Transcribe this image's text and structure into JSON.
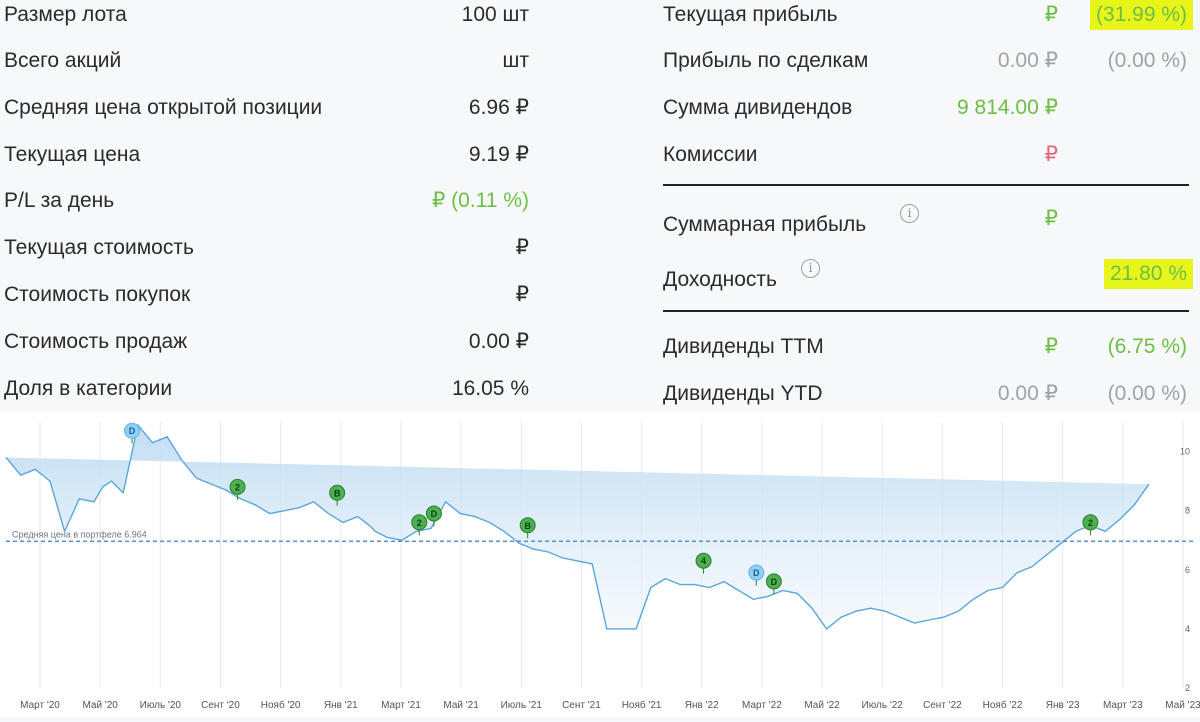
{
  "left": [
    {
      "label": "Размер лота",
      "value": "100 шт",
      "cls": ""
    },
    {
      "label": "Всего акций",
      "value": "шт",
      "cls": ""
    },
    {
      "label": "Средняя цена открытой позиции",
      "value": "6.96 ₽",
      "cls": ""
    },
    {
      "label": "Текущая цена",
      "value": "9.19 ₽",
      "cls": ""
    },
    {
      "label": "P/L за день",
      "value": "₽ (0.11 %)",
      "cls": "green"
    },
    {
      "label": "Текущая стоимость",
      "value": "₽",
      "cls": ""
    },
    {
      "label": "Стоимость покупок",
      "value": "₽",
      "cls": ""
    },
    {
      "label": "Стоимость продаж",
      "value": "0.00 ₽",
      "cls": ""
    },
    {
      "label": "Доля в категории",
      "value": "16.05 %",
      "cls": ""
    }
  ],
  "right": {
    "current_profit": {
      "label": "Текущая прибыль",
      "value": "₽",
      "pct": "(31.99 %)"
    },
    "trade_profit": {
      "label": "Прибыль по сделкам",
      "value": "0.00 ₽",
      "pct": "(0.00 %)"
    },
    "dividends_sum": {
      "label": "Сумма дивидендов",
      "value": "9 814.00 ₽"
    },
    "commissions": {
      "label": "Комиссии",
      "value": "₽"
    },
    "total_profit": {
      "label": "Суммарная прибыль",
      "value": "₽",
      "info": "i"
    },
    "yield": {
      "label": "Доходность",
      "pct": "21.80 %",
      "info": "i"
    },
    "div_ttm": {
      "label": "Дивиденды TTM",
      "value": "₽",
      "pct": "(6.75 %)"
    },
    "div_ytd": {
      "label": "Дивиденды YTD",
      "value": "0.00 ₽",
      "pct": "(0.00 %)"
    }
  },
  "colors": {
    "green": "#6cbf47",
    "highlight": "#e8f51a",
    "line": "#5aa6dd",
    "avg_line": "#3a7fc0",
    "marker_green": "#4caf50",
    "marker_blue": "#8fd0f5"
  },
  "chart_data": {
    "type": "area",
    "avg_label": "Средняя цена в портфеле 6.964",
    "avg_value": 6.964,
    "ylim": [
      2,
      11
    ],
    "yticks": [
      "2",
      "4",
      "6",
      "8",
      "10"
    ],
    "xticks": [
      "Март '20",
      "Май '20",
      "Июль '20",
      "Сент '20",
      "Нояб '20",
      "Янв '21",
      "Март '21",
      "Май '21",
      "Июль '21",
      "Сент '21",
      "Нояб '21",
      "Янв '22",
      "Март '22",
      "Май '22",
      "Июль '22",
      "Сент '22",
      "Нояб '22",
      "Янв '23",
      "Март '23",
      "Май '23"
    ],
    "x": [
      0,
      0.5,
      1,
      1.5,
      2,
      2.5,
      3,
      3.3,
      3.6,
      4,
      4.5,
      5,
      5.5,
      6,
      6.5,
      7,
      7.5,
      8,
      8.5,
      9,
      9.5,
      10,
      10.5,
      11,
      11.5,
      12,
      12.4,
      12.6,
      13,
      13.5,
      14,
      14.5,
      15,
      15.5,
      16,
      16.5,
      17,
      17.5,
      18,
      18.5,
      19,
      19.5,
      20,
      20.5,
      21,
      21.5,
      22,
      22.5,
      23,
      23.5,
      24,
      24.5,
      25,
      25.5,
      26,
      26.5,
      27,
      27.5,
      28,
      28.5,
      29,
      29.5,
      30,
      30.5,
      31,
      31.5,
      32,
      32.5,
      33,
      33.5,
      34,
      34.5,
      35,
      35.5,
      36,
      36.5,
      37,
      37.5,
      38,
      38.5,
      39,
      39.5,
      40,
      40.5
    ],
    "y": [
      9.8,
      9.2,
      9.4,
      9.0,
      7.3,
      8.4,
      8.3,
      8.8,
      9.0,
      8.6,
      10.9,
      10.3,
      10.5,
      9.7,
      9.1,
      8.9,
      8.7,
      8.4,
      8.2,
      7.9,
      8.0,
      8.1,
      8.3,
      7.9,
      7.6,
      7.8,
      7.5,
      7.3,
      7.1,
      7.0,
      7.3,
      7.4,
      8.3,
      7.9,
      7.8,
      7.6,
      7.3,
      6.9,
      6.7,
      6.6,
      6.4,
      6.3,
      6.2,
      4.0,
      4.0,
      4.0,
      5.4,
      5.7,
      5.5,
      5.5,
      5.4,
      5.6,
      5.3,
      5.0,
      5.1,
      5.3,
      5.2,
      4.7,
      4.0,
      4.4,
      4.6,
      4.7,
      4.6,
      4.4,
      4.2,
      4.3,
      4.4,
      4.6,
      5.0,
      5.3,
      5.4,
      5.9,
      6.1,
      6.5,
      6.9,
      7.3,
      7.5,
      7.3,
      7.7,
      8.2,
      8.9
    ],
    "markers": [
      {
        "label": "D",
        "x": 4.3,
        "y": 10.3,
        "kind": "blue"
      },
      {
        "label": "2",
        "x": 7.9,
        "y": 8.4,
        "kind": "green"
      },
      {
        "label": "B",
        "x": 11.3,
        "y": 8.2,
        "kind": "green"
      },
      {
        "label": "2",
        "x": 14.1,
        "y": 7.2,
        "kind": "green"
      },
      {
        "label": "D",
        "x": 14.6,
        "y": 7.5,
        "kind": "green"
      },
      {
        "label": "B",
        "x": 17.8,
        "y": 7.1,
        "kind": "green"
      },
      {
        "label": "4",
        "x": 23.8,
        "y": 5.9,
        "kind": "green"
      },
      {
        "label": "D",
        "x": 25.6,
        "y": 5.5,
        "kind": "blue"
      },
      {
        "label": "D",
        "x": 26.2,
        "y": 5.2,
        "kind": "green"
      },
      {
        "label": "2",
        "x": 37.0,
        "y": 7.2,
        "kind": "green"
      }
    ]
  }
}
